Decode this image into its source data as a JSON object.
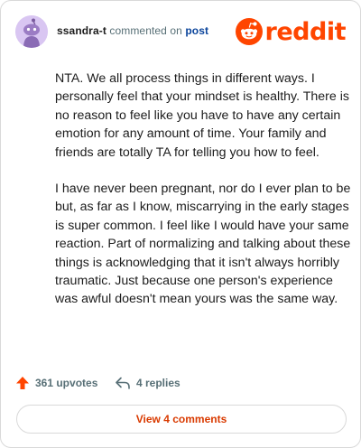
{
  "header": {
    "username": "ssandra-t",
    "action_text": "commented on",
    "post_link": "post",
    "logo_text": "reddit"
  },
  "comment": {
    "paragraphs": [
      "NTA. We all process things in different ways. I personally feel that your mindset is healthy. There is no reason to feel like you have to have any certain emotion for any amount of time. Your family and friends are totally TA for telling you how to feel.",
      "I have never been pregnant, nor do I ever plan to be but, as far as I know, miscarrying in the early stages is super common. I feel like I would have your same reaction. Part of normalizing and talking about these things is acknowledging that it isn't always horribly traumatic. Just because one person's experience was awful doesn't mean yours was the same way."
    ]
  },
  "actions": {
    "upvotes_label": "361 upvotes",
    "replies_label": "4 replies"
  },
  "footer": {
    "view_comments_label": "View 4 comments"
  },
  "colors": {
    "brand": "#ff4500",
    "link": "#0a449b",
    "muted": "#576f76",
    "button_text": "#d93a00"
  }
}
